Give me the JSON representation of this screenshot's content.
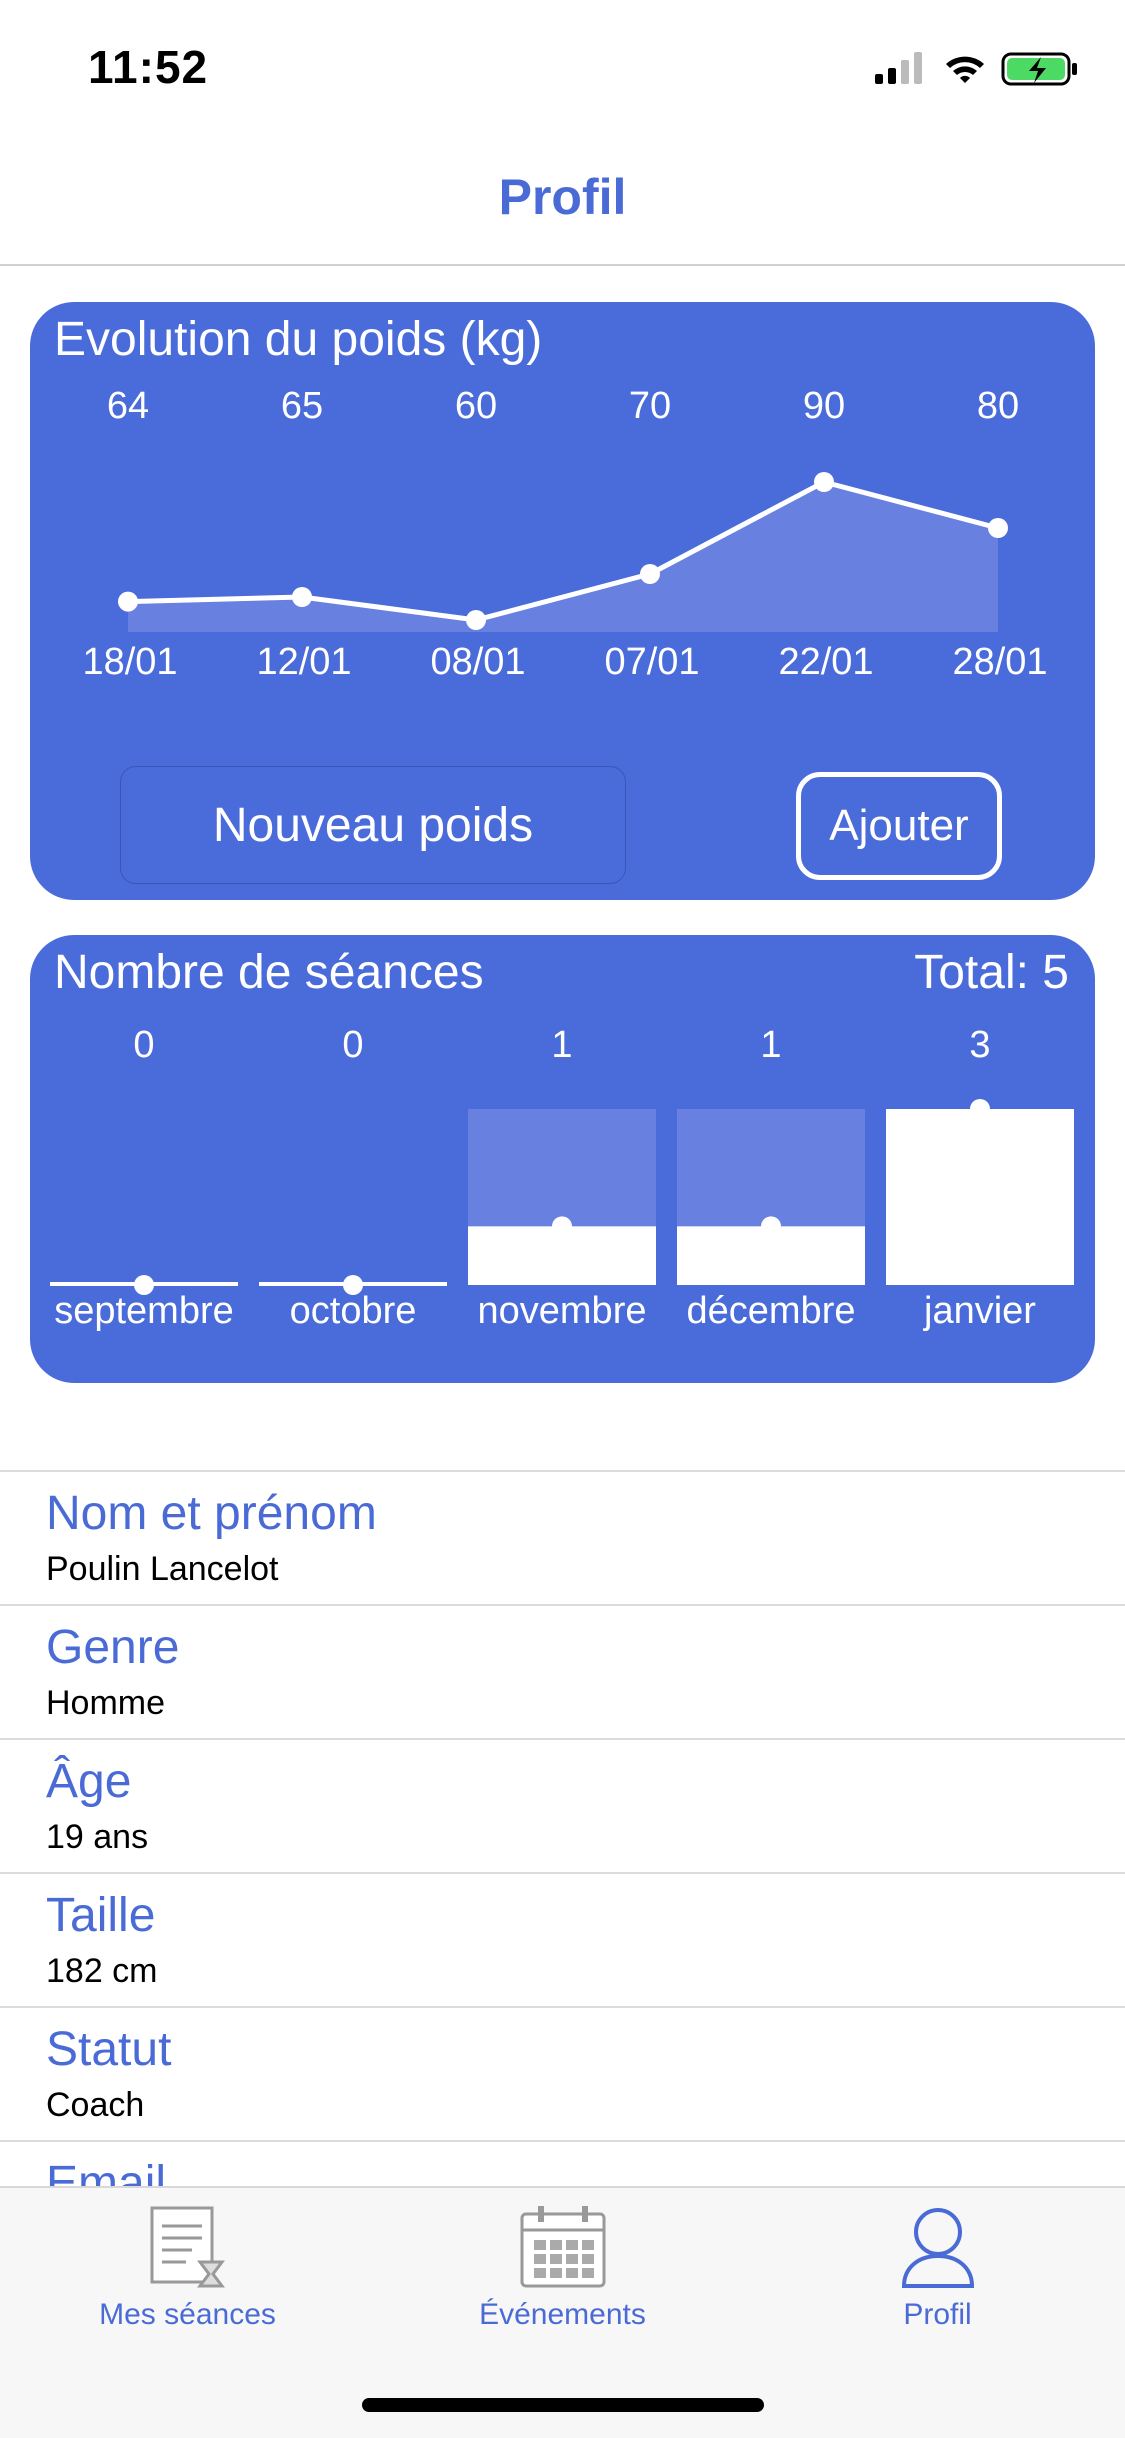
{
  "status": {
    "time": "11:52"
  },
  "nav": {
    "title": "Profil"
  },
  "weight_card": {
    "title": "Evolution du poids (kg)",
    "input_placeholder": "Nouveau poids",
    "add_label": "Ajouter"
  },
  "sessions_card": {
    "title": "Nombre de séances",
    "total": "Total: 5"
  },
  "chart_data": [
    {
      "type": "area",
      "title": "Evolution du poids (kg)",
      "categories": [
        "18/01",
        "12/01",
        "08/01",
        "07/01",
        "22/01",
        "28/01"
      ],
      "values": [
        64,
        65,
        60,
        70,
        90,
        80
      ],
      "data_labels": [
        "64",
        "65",
        "60",
        "70",
        "90",
        "80"
      ]
    },
    {
      "type": "bar",
      "title": "Nombre de séances",
      "categories": [
        "septembre",
        "octobre",
        "novembre",
        "décembre",
        "janvier"
      ],
      "values": [
        0,
        0,
        1,
        1,
        3
      ],
      "data_labels": [
        "0",
        "0",
        "1",
        "1",
        "3"
      ]
    }
  ],
  "profile": [
    {
      "label": "Nom et prénom",
      "value": "Poulin Lancelot"
    },
    {
      "label": "Genre",
      "value": "Homme"
    },
    {
      "label": "Âge",
      "value": "19 ans"
    },
    {
      "label": "Taille",
      "value": "182 cm"
    },
    {
      "label": "Statut",
      "value": "Coach"
    },
    {
      "label": "Email",
      "value": ""
    }
  ],
  "tabs": [
    {
      "label": "Mes séances",
      "icon": "sessions-icon"
    },
    {
      "label": "Événements",
      "icon": "calendar-icon"
    },
    {
      "label": "Profil",
      "icon": "profile-icon"
    }
  ],
  "colors": {
    "accent": "#4a6bd6",
    "card": "#4a6bda",
    "card_fill": "#6880e0"
  }
}
